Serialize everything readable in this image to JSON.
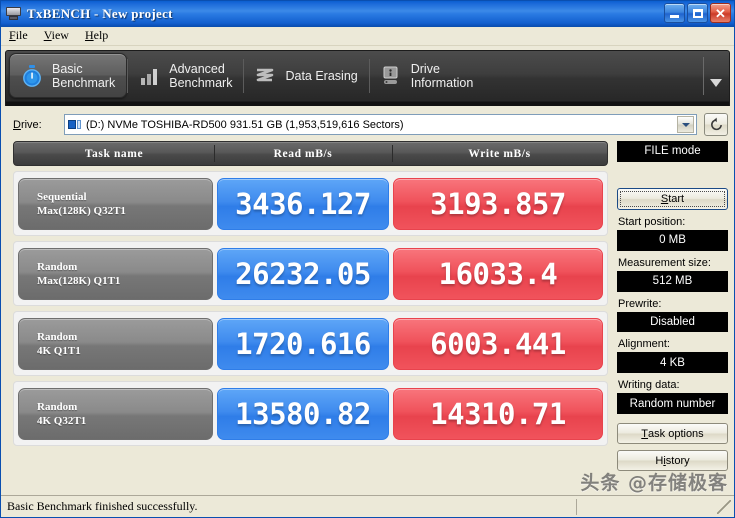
{
  "window": {
    "title": "TxBENCH - New project",
    "icon": "app-window-icon",
    "buttons": {
      "minimize": "minimize",
      "maximize": "maximize",
      "close": "close"
    }
  },
  "menubar": {
    "items": [
      {
        "label": "File",
        "accel": "F"
      },
      {
        "label": "View",
        "accel": "V"
      },
      {
        "label": "Help",
        "accel": "H"
      }
    ]
  },
  "tabs": [
    {
      "label": "Basic\nBenchmark",
      "icon": "stopwatch-icon",
      "active": true
    },
    {
      "label": "Advanced\nBenchmark",
      "icon": "bar-chart-icon",
      "active": false
    },
    {
      "label": "Data Erasing",
      "icon": "shred-icon",
      "active": false
    },
    {
      "label": "Drive\nInformation",
      "icon": "drive-info-icon",
      "active": false
    }
  ],
  "tab_overflow_icon": "chevron-down-icon",
  "drive": {
    "label": "Drive:",
    "accel": "D",
    "selected": "(D:) NVMe TOSHIBA-RD500  931.51 GB (1,953,519,616 Sectors)",
    "icon": "drive-icon",
    "dropdown_icon": "chevron-down-icon",
    "refresh_icon": "refresh-icon"
  },
  "results": {
    "columns": [
      "Task name",
      "Read mB/s",
      "Write mB/s"
    ],
    "rows": [
      {
        "task_line1": "Sequential",
        "task_line2": "Max(128K) Q32T1",
        "read": "3436.127",
        "write": "3193.857"
      },
      {
        "task_line1": "Random",
        "task_line2": "Max(128K) Q1T1",
        "read": "26232.05",
        "write": "16033.4"
      },
      {
        "task_line1": "Random",
        "task_line2": "4K Q1T1",
        "read": "1720.616",
        "write": "6003.441"
      },
      {
        "task_line1": "Random",
        "task_line2": "4K Q32T1",
        "read": "13580.82",
        "write": "14310.71"
      }
    ]
  },
  "sidebar": {
    "mode_badge": "FILE mode",
    "start_button": "Start",
    "start_accel": "S",
    "fields": [
      {
        "label": "Start position:",
        "value": "0 MB"
      },
      {
        "label": "Measurement size:",
        "value": "512 MB"
      },
      {
        "label": "Prewrite:",
        "value": "Disabled"
      },
      {
        "label": "Alignment:",
        "value": "4 KB"
      },
      {
        "label": "Writing data:",
        "value": "Random number"
      }
    ],
    "task_options_button": "Task options",
    "task_options_accel": "T",
    "history_button": "History",
    "history_accel": "i"
  },
  "statusbar": {
    "message": "Basic Benchmark finished successfully."
  },
  "watermark": "头条 @存储极客",
  "colors": {
    "read_blue": "#3f8bee",
    "write_red": "#f0525b",
    "task_gray": "#8a8a8a",
    "titlebar_blue": "#2a7ae2",
    "window_face": "#ece9d8",
    "lcd_black": "#000000"
  }
}
